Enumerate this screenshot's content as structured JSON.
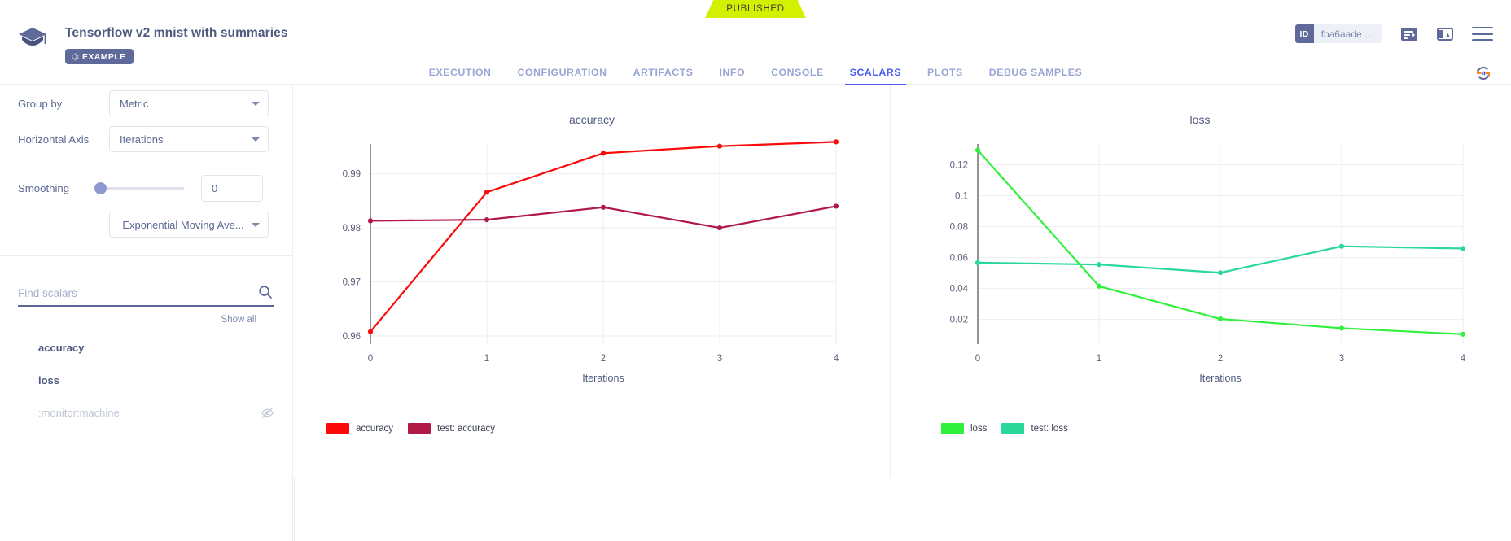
{
  "ribbon": {
    "label": "PUBLISHED"
  },
  "header": {
    "title": "Tensorflow v2 mnist with summaries",
    "example_tag": "EXAMPLE",
    "id_key": "ID",
    "id_value": "fba6aade ...",
    "icons": [
      "logo-graduation-icon",
      "id-badge-icon",
      "report-icon",
      "layout-icon",
      "hamburger-menu-icon"
    ]
  },
  "tabs": [
    {
      "label": "EXECUTION",
      "active": false
    },
    {
      "label": "CONFIGURATION",
      "active": false
    },
    {
      "label": "ARTIFACTS",
      "active": false
    },
    {
      "label": "INFO",
      "active": false
    },
    {
      "label": "CONSOLE",
      "active": false
    },
    {
      "label": "SCALARS",
      "active": true
    },
    {
      "label": "PLOTS",
      "active": false
    },
    {
      "label": "DEBUG SAMPLES",
      "active": false
    }
  ],
  "sidebar": {
    "group_by": {
      "label": "Group by",
      "value": "Metric"
    },
    "horizontal_axis": {
      "label": "Horizontal Axis",
      "value": "Iterations"
    },
    "smoothing": {
      "label": "Smoothing",
      "value": "0",
      "algorithm": "Exponential Moving Ave..."
    },
    "search": {
      "placeholder": "Find scalars",
      "value": ""
    },
    "show_all": "Show all",
    "scalars": [
      {
        "label": "accuracy",
        "hidden": false
      },
      {
        "label": "loss",
        "hidden": false
      },
      {
        "label": ":monitor:machine",
        "hidden": true
      }
    ]
  },
  "colors": {
    "accent": "#4a5bf5",
    "published": "#d2f000",
    "brand_navy": "#5f6a9a",
    "accuracy": "#fa0a0a",
    "test_accuracy": "#b01846",
    "loss": "#2ff03a",
    "test_loss": "#2ad89a"
  },
  "chart_data": [
    {
      "type": "line",
      "title": "accuracy",
      "xlabel": "Iterations",
      "ylabel": "",
      "x": [
        0,
        1,
        2,
        3,
        4
      ],
      "xticks": [
        "0",
        "1",
        "2",
        "3",
        "4"
      ],
      "yticks": [
        "0.96",
        "0.97",
        "0.98",
        "0.99"
      ],
      "ylim": [
        0.9585,
        0.9955
      ],
      "xlim": [
        0,
        4
      ],
      "grid": true,
      "legend_position": "bottom-left",
      "series": [
        {
          "name": "accuracy",
          "color": "#fa0a0a",
          "values": [
            0.9608,
            0.9866,
            0.9938,
            0.9951,
            0.9959
          ]
        },
        {
          "name": "test: accuracy",
          "color": "#b01846",
          "values": [
            0.9813,
            0.9815,
            0.9838,
            0.98,
            0.984
          ]
        }
      ]
    },
    {
      "type": "line",
      "title": "loss",
      "xlabel": "Iterations",
      "ylabel": "",
      "x": [
        0,
        1,
        2,
        3,
        4
      ],
      "xticks": [
        "0",
        "1",
        "2",
        "3",
        "4"
      ],
      "yticks": [
        "0.02",
        "0.04",
        "0.06",
        "0.08",
        "0.1",
        "0.12"
      ],
      "ylim": [
        0.004,
        0.1335
      ],
      "xlim": [
        0,
        4
      ],
      "grid": true,
      "legend_position": "bottom-left",
      "series": [
        {
          "name": "loss",
          "color": "#2ff03a",
          "values": [
            0.1295,
            0.0415,
            0.0203,
            0.0143,
            0.0104
          ]
        },
        {
          "name": "test: loss",
          "color": "#2ad89a",
          "values": [
            0.0567,
            0.0555,
            0.0502,
            0.0673,
            0.0659
          ]
        }
      ]
    }
  ]
}
